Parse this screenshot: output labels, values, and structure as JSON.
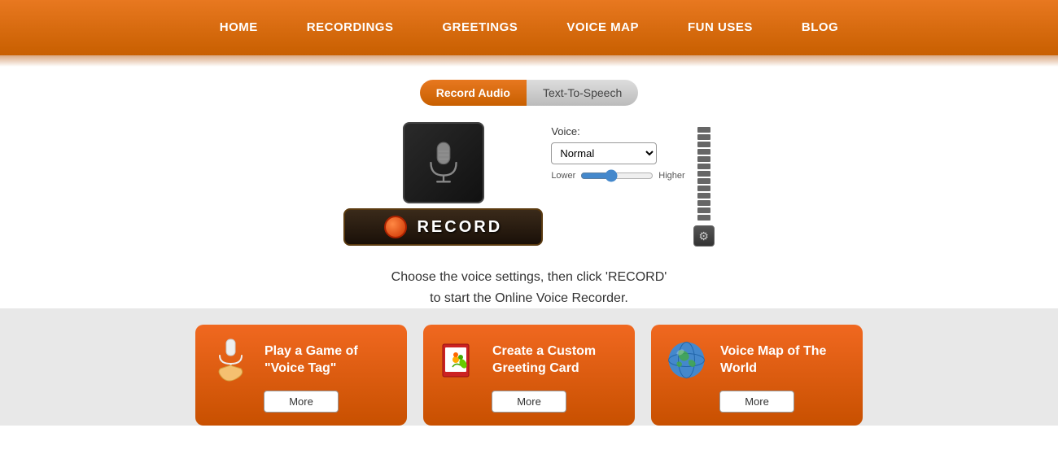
{
  "nav": {
    "items": [
      {
        "id": "home",
        "label": "HOME"
      },
      {
        "id": "recordings",
        "label": "RECORDINGS"
      },
      {
        "id": "greetings",
        "label": "GREETINGS"
      },
      {
        "id": "voice-map",
        "label": "VOICE MAP"
      },
      {
        "id": "fun-uses",
        "label": "FUN USES"
      },
      {
        "id": "blog",
        "label": "BLOG"
      }
    ]
  },
  "tabs": {
    "record_audio": "Record Audio",
    "text_to_speech": "Text-To-Speech"
  },
  "recorder": {
    "voice_label": "Voice:",
    "voice_default": "Normal",
    "pitch_lower": "Lower",
    "pitch_higher": "Higher",
    "record_button": "RECORD",
    "instruction_line1": "Choose the voice settings, then click 'RECORD'",
    "instruction_line2": "to start the Online Voice Recorder."
  },
  "cards": [
    {
      "id": "voice-tag",
      "icon": "🎤",
      "title": "Play a Game of \"Voice Tag\"",
      "more_label": "More"
    },
    {
      "id": "greeting-card",
      "icon": "🎴",
      "title": "Create a Custom Greeting Card",
      "more_label": "More"
    },
    {
      "id": "voice-map",
      "icon": "🌍",
      "title": "Voice Map of The World",
      "more_label": "More"
    }
  ]
}
